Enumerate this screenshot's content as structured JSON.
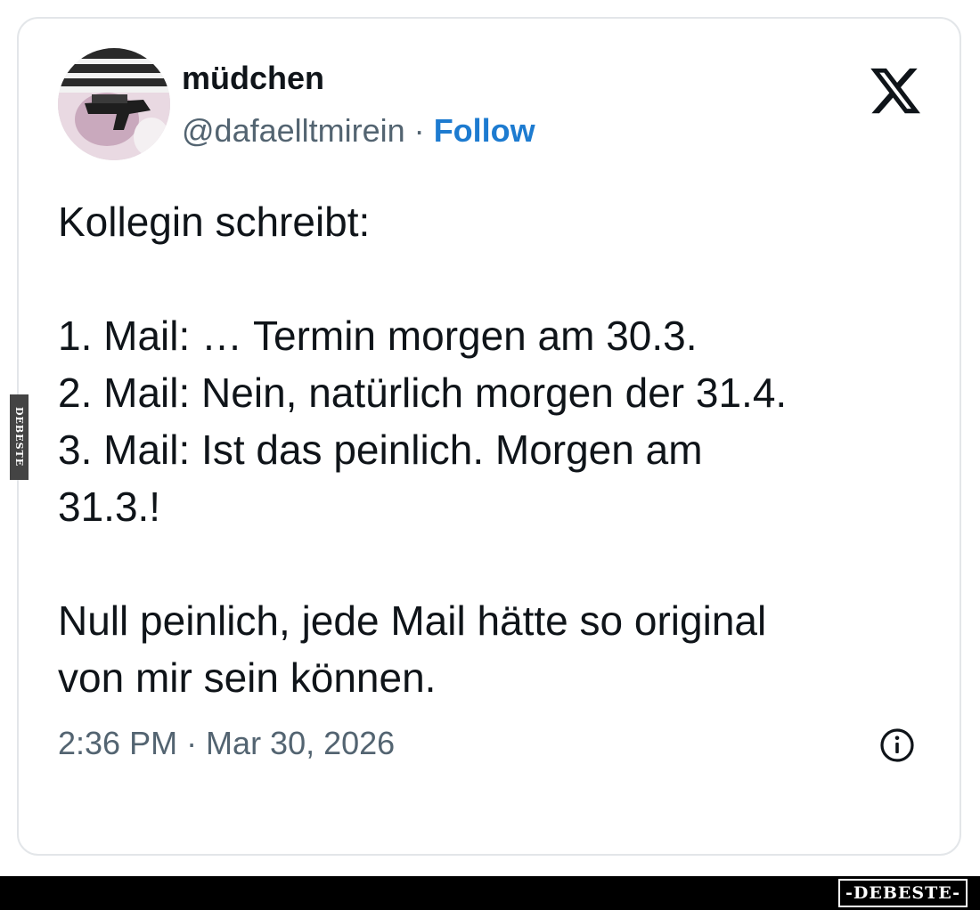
{
  "tweet": {
    "author": {
      "display_name": "müdchen",
      "handle": "@dafaelltmirein",
      "separator": "·",
      "follow_label": "Follow"
    },
    "brand_icon": "x-logo-icon",
    "text_lines": [
      "Kollegin schreibt:",
      "",
      "1. Mail: … Termin morgen am 30.3.",
      "2. Mail: Nein, natürlich morgen der 31.4.",
      "3. Mail: Ist das peinlich. Morgen am",
      "31.3.!",
      "",
      "Null peinlich, jede Mail hätte so original",
      "von mir sein können."
    ],
    "timestamp": "2:36 PM · Mar 30, 2026",
    "info_icon": "info-icon"
  },
  "watermark": {
    "side_text": "DEBESTE",
    "bottom_logo": "-DEBESTE-"
  },
  "colors": {
    "text_primary": "#0f1419",
    "text_secondary": "#536471",
    "follow_blue": "#1d7bd0",
    "card_border": "#e3e6e9"
  }
}
